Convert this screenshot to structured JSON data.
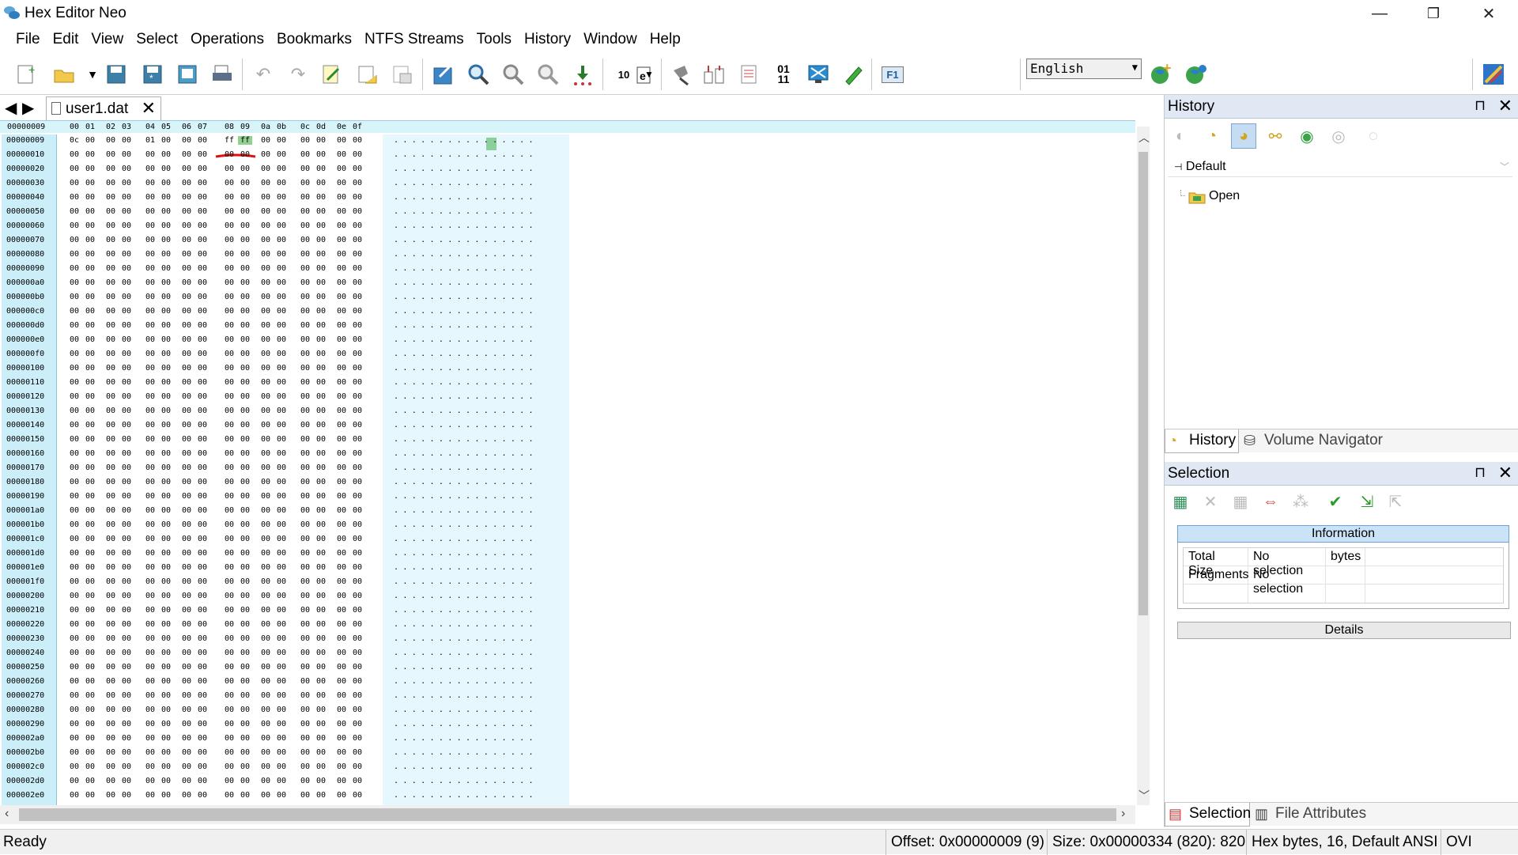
{
  "window": {
    "title": "Hex Editor Neo",
    "minimize": "—",
    "restore": "❐",
    "close": "✕"
  },
  "menu": [
    "File",
    "Edit",
    "View",
    "Select",
    "Operations",
    "Bookmarks",
    "NTFS Streams",
    "Tools",
    "History",
    "Window",
    "Help"
  ],
  "toolbar": {
    "language": "English",
    "icons": [
      "new-file-icon",
      "open-file-icon",
      "save-icon",
      "save-all-icon",
      "save-as-icon",
      "print-icon",
      "undo-icon",
      "redo-icon",
      "edit-icon",
      "import-icon",
      "export-icon",
      "goto-icon",
      "find-icon",
      "find-next-icon",
      "find-prev-icon",
      "replace-icon",
      "bits-icon",
      "file-properties-icon",
      "clipboard-icon",
      "bookmarks-icon",
      "structure-icon",
      "binary-view-icon",
      "fullscreen-icon",
      "pen-icon",
      "help-f1-icon",
      "language-add-icon",
      "language-globe-icon",
      "tool-icon"
    ],
    "binary_label": "01\n11",
    "help_label": "F1"
  },
  "document": {
    "tab_name": "user1.dat"
  },
  "hex": {
    "header_offset": "00000009",
    "columns": [
      "00",
      "01",
      "02",
      "03",
      "04",
      "05",
      "06",
      "07",
      "08",
      "09",
      "0a",
      "0b",
      "0c",
      "0d",
      "0e",
      "0f"
    ],
    "first_row": [
      "0c",
      "00",
      "00",
      "00",
      "01",
      "00",
      "00",
      "00",
      "ff",
      "ff",
      "00",
      "00",
      "00",
      "00",
      "00",
      "00"
    ],
    "zero_byte": "00",
    "offsets": [
      "00000009",
      "00000010",
      "00000020",
      "00000030",
      "00000040",
      "00000050",
      "00000060",
      "00000070",
      "00000080",
      "00000090",
      "000000a0",
      "000000b0",
      "000000c0",
      "000000d0",
      "000000e0",
      "000000f0",
      "00000100",
      "00000110",
      "00000120",
      "00000130",
      "00000140",
      "00000150",
      "00000160",
      "00000170",
      "00000180",
      "00000190",
      "000001a0",
      "000001b0",
      "000001c0",
      "000001d0",
      "000001e0",
      "000001f0",
      "00000200",
      "00000210",
      "00000220",
      "00000230",
      "00000240",
      "00000250",
      "00000260",
      "00000270",
      "00000280",
      "00000290",
      "000002a0",
      "000002b0",
      "000002c0",
      "000002d0",
      "000002e0"
    ],
    "char_dots": "................"
  },
  "history_panel": {
    "title": "History",
    "group": "Default",
    "entries": [
      "Open"
    ]
  },
  "history_tabs": [
    "History",
    "Volume Navigator"
  ],
  "selection_panel": {
    "title": "Selection",
    "info_header": "Information",
    "rows": [
      {
        "label": "Total Size",
        "value": "No selection",
        "unit": "bytes"
      },
      {
        "label": "Fragments",
        "value": "No selection",
        "unit": ""
      }
    ],
    "details": "Details"
  },
  "selection_tabs": [
    "Selection",
    "File Attributes"
  ],
  "status": {
    "ready": "Ready",
    "offset": "Offset: 0x00000009 (9)",
    "size": "Size: 0x00000334 (820): 820",
    "mode": "Hex bytes, 16, Default ANSI",
    "ovr": "OVI"
  }
}
